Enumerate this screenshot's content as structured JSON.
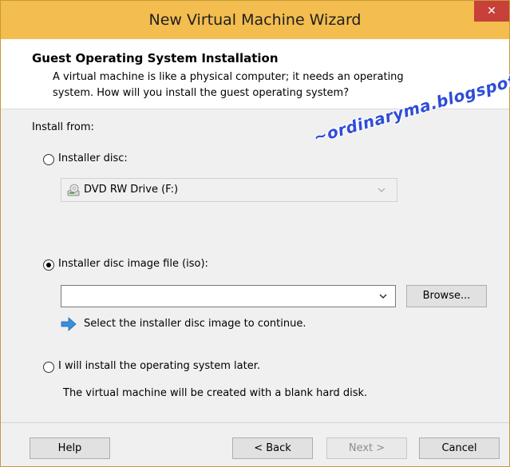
{
  "window": {
    "title": "New Virtual Machine Wizard",
    "close_glyph": "✕"
  },
  "header": {
    "title": "Guest Operating System Installation",
    "description_line1": "A virtual machine is like a physical computer; it needs an operating",
    "description_line2": "system. How will you install the guest operating system?"
  },
  "watermark": "~ordinaryma.blogspot.com~",
  "install_from_label": "Install from:",
  "options": {
    "installer_disc": {
      "label": "Installer disc:",
      "selected": false,
      "drive_value": "DVD RW Drive (F:)",
      "drive_icon": "dvd-drive-icon"
    },
    "disc_image": {
      "label": "Installer disc image file (iso):",
      "selected": true,
      "value": "",
      "browse_label": "Browse...",
      "hint": "Select the installer disc image to continue.",
      "hint_icon": "info-arrow-icon"
    },
    "install_later": {
      "label": "I will install the operating system later.",
      "selected": false,
      "description": "The virtual machine will be created with a blank hard disk."
    }
  },
  "buttons": {
    "help": "Help",
    "back": "< Back",
    "next": "Next >",
    "cancel": "Cancel"
  },
  "colors": {
    "titlebar": "#f3bd4f",
    "close": "#c7403a",
    "watermark": "#2f4cd8"
  }
}
